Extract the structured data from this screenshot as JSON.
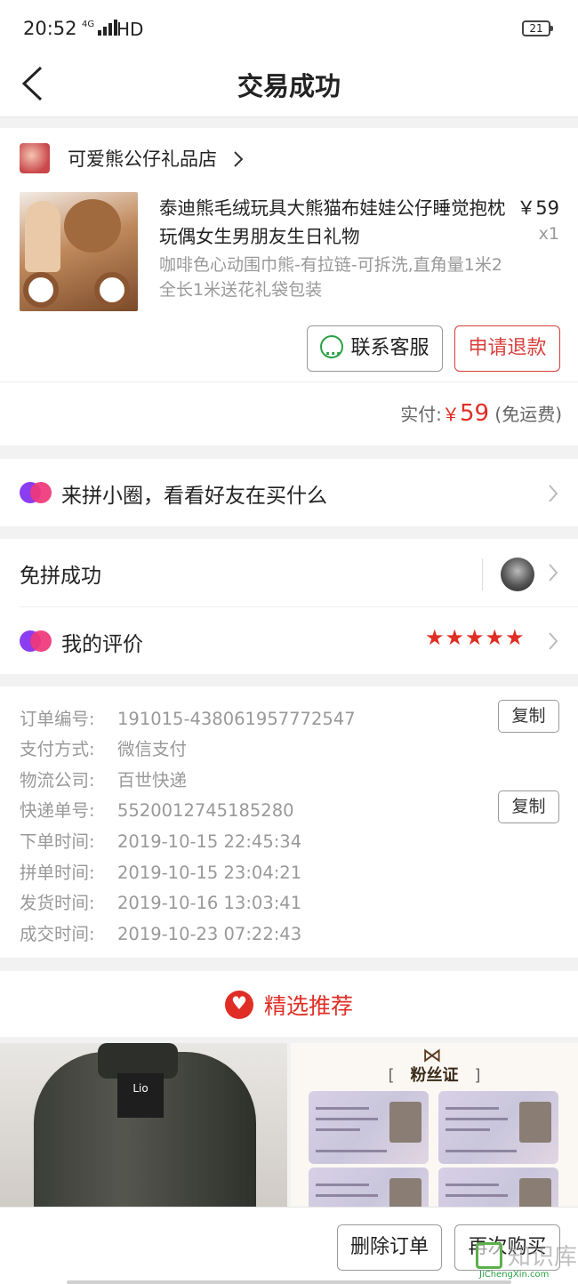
{
  "status_bar": {
    "time": "20:52",
    "network": "4G",
    "hd": "HD",
    "battery": "21"
  },
  "header": {
    "title": "交易成功"
  },
  "shop": {
    "name": "可爱熊公仔礼品店"
  },
  "product": {
    "title": "泰迪熊毛绒玩具大熊猫布娃娃公仔睡觉抱枕玩偶女生男朋友生日礼物",
    "price": "￥59",
    "quantity": "x1",
    "spec": "咖啡色心动围巾熊-有拉链-可拆洗,直角量1米2全长1米送花礼袋包装"
  },
  "actions": {
    "contact_label": "联系客服",
    "refund_label": "申请退款"
  },
  "payment": {
    "label": "实付:",
    "currency": "￥",
    "amount": "59",
    "note": "(免运费)"
  },
  "circle": {
    "label": "来拼小圈，看看好友在买什么"
  },
  "group": {
    "label": "免拼成功"
  },
  "review": {
    "label": "我的评价",
    "rating": 5
  },
  "order_info": {
    "rows": [
      {
        "label": "订单编号:",
        "value": "191015-438061957772547"
      },
      {
        "label": "支付方式:",
        "value": "微信支付"
      },
      {
        "label": "物流公司:",
        "value": "百世快递"
      },
      {
        "label": "快递单号:",
        "value": "5520012745185280"
      },
      {
        "label": "下单时间:",
        "value": "2019-10-15 22:45:34"
      },
      {
        "label": "拼单时间:",
        "value": "2019-10-15 23:04:21"
      },
      {
        "label": "发货时间:",
        "value": "2019-10-16 13:03:41"
      },
      {
        "label": "成交时间:",
        "value": "2019-10-23 07:22:43"
      }
    ],
    "copy_label": "复制"
  },
  "recommend": {
    "title": "精选推荐",
    "item1": {
      "shirt_text": "Lio"
    },
    "item2": {
      "heading": "粉丝证",
      "open_bracket": "[",
      "close_bracket": "]"
    }
  },
  "bottom_bar": {
    "delete_label": "删除订单",
    "rebuy_label": "再次购买"
  },
  "watermark": {
    "text": "知识库",
    "url": "JiChengXin.com"
  },
  "colors": {
    "accent": "#e02e24",
    "green": "#2aa145",
    "purple": "#8b3df0",
    "pink": "#f0367a"
  }
}
